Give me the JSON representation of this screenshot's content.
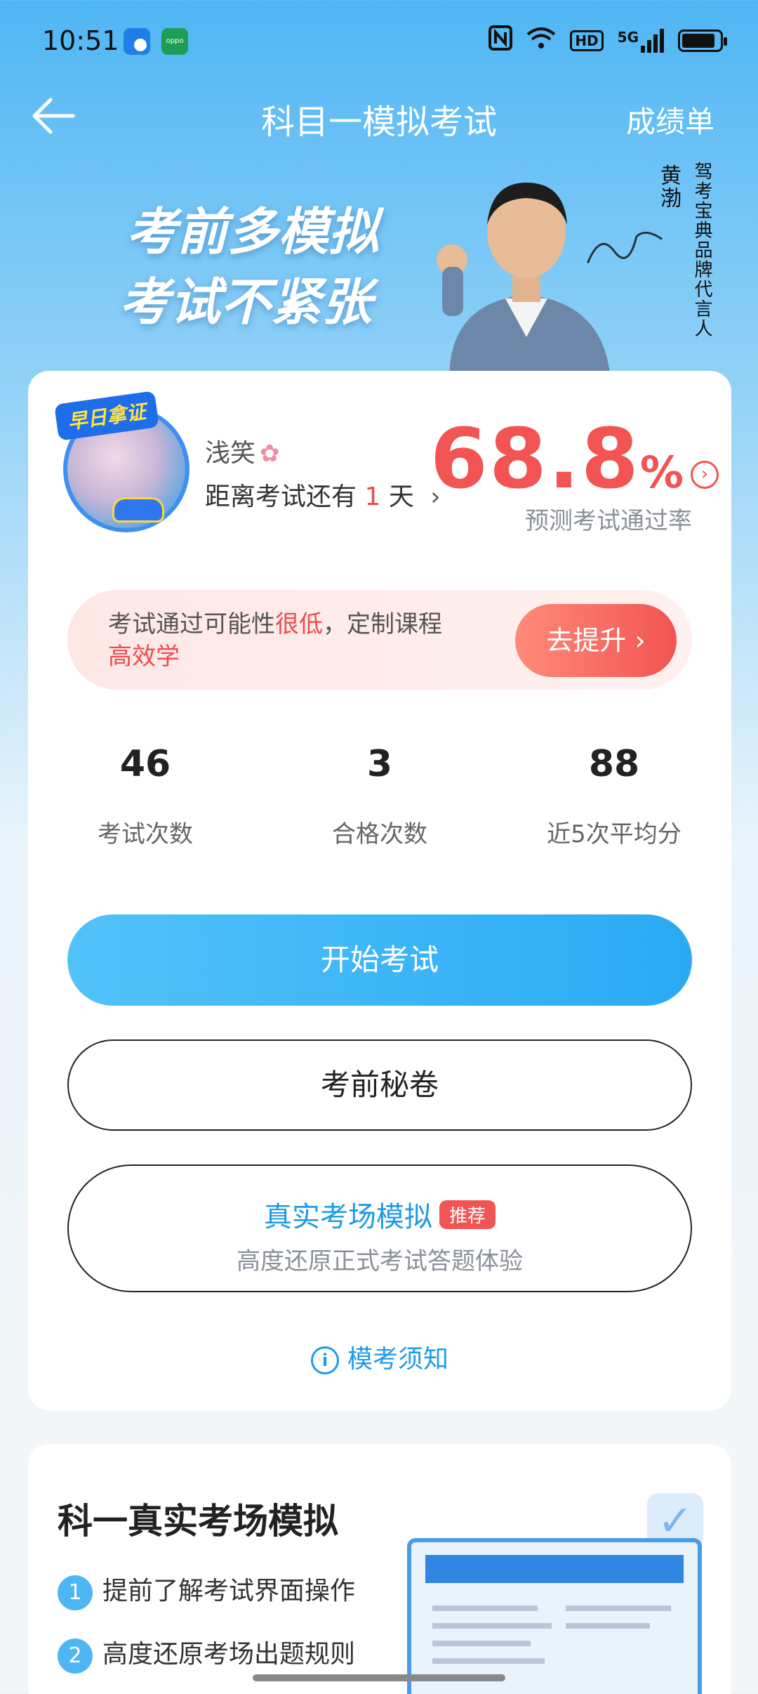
{
  "status_bar": {
    "time": "10:51",
    "right_icons": [
      "nfc-icon",
      "wifi-icon",
      "hd-icon",
      "5g-signal-icon",
      "battery-icon"
    ],
    "hd_label": "HD",
    "network_label": "5G"
  },
  "header": {
    "title": "科目一模拟考试",
    "right_link": "成绩单"
  },
  "banner": {
    "slogan_line1": "考前多模拟",
    "slogan_line2": "考试不紧张",
    "spokesperson_name": "黄渤",
    "spokesperson_title": "驾考宝典品牌代言人"
  },
  "profile": {
    "avatar_badge": "早日拿证",
    "username": "浅笑",
    "countdown_prefix": "距离考试还有",
    "countdown_days": "1",
    "countdown_suffix": "天"
  },
  "prediction": {
    "rate": "68.8",
    "unit": "%",
    "caption": "预测考试通过率"
  },
  "promo": {
    "text_prefix": "考试通过可能性",
    "text_highlight": "很低",
    "text_suffix": "，定制课程",
    "text_line2": "高效学",
    "button": "去提升"
  },
  "stats": [
    {
      "value": "46",
      "label": "考试次数"
    },
    {
      "value": "3",
      "label": "合格次数"
    },
    {
      "value": "88",
      "label": "近5次平均分"
    }
  ],
  "buttons": {
    "start": "开始考试",
    "secret": "考前秘卷",
    "real_title": "真实考场模拟",
    "real_tag": "推荐",
    "real_sub": "高度还原正式考试答题体验"
  },
  "notice": "模考须知",
  "section2": {
    "title": "科一真实考场模拟",
    "features": [
      {
        "num": "1",
        "text": "提前了解考试界面操作"
      },
      {
        "num": "2",
        "text": "高度还原考场出题规则"
      }
    ]
  },
  "colors": {
    "accent_blue": "#2aaaf4",
    "accent_red": "#f25453"
  }
}
